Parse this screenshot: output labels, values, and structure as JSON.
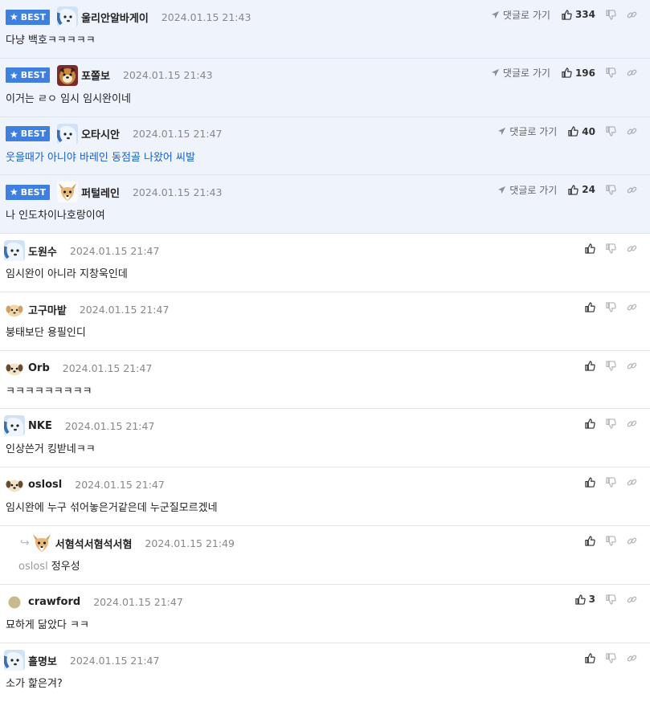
{
  "badge_label": "BEST",
  "go_label": "댓글로 가기",
  "best": [
    {
      "nick": "울리안알바게이",
      "time": "2024.01.15 21:43",
      "text": "다냥 백호ㅋㅋㅋㅋㅋ",
      "likes": "334",
      "avatar": "puppy-blue"
    },
    {
      "nick": "포쫄보",
      "time": "2024.01.15 21:43",
      "text": "이거는 ㄹㅇ 임시 임시완이네",
      "likes": "196",
      "avatar": "dog-red"
    },
    {
      "nick": "오타시안",
      "time": "2024.01.15 21:47",
      "text": "웃을때가 아니야 바레인 동점골 나왔어 씨발",
      "likes": "40",
      "avatar": "puppy-blue"
    },
    {
      "nick": "퍼털레인",
      "time": "2024.01.15 21:43",
      "text": "나 인도차이나호랑이여",
      "likes": "24",
      "avatar": "fox"
    }
  ],
  "comments": [
    {
      "nick": "도원수",
      "time": "2024.01.15 21:47",
      "text": "임시완이 아니라 지창욱인데",
      "avatar": "puppy-blue"
    },
    {
      "nick": "고구마밭",
      "time": "2024.01.15 21:47",
      "text": "붕태보단 용필인디",
      "avatar": "puppy-light"
    },
    {
      "nick": "Orb",
      "time": "2024.01.15 21:47",
      "text": "ㅋㅋㅋㅋㅋㅋㅋㅋㅋ",
      "avatar": "puppy-dark"
    },
    {
      "nick": "NKE",
      "time": "2024.01.15 21:47",
      "text": "인상쓴거 킹받네ㅋㅋ",
      "avatar": "puppy-blue"
    },
    {
      "nick": "oslosl",
      "time": "2024.01.15 21:47",
      "text": "임시완에 누구 섞어놓은거같은데 누군질모르겠네",
      "avatar": "puppy-dark"
    },
    {
      "nick": "서혐석서혐석서혐",
      "time": "2024.01.15 21:49",
      "mention": "oslosl",
      "text": "정우성",
      "avatar": "fox",
      "reply": true
    },
    {
      "nick": "crawford",
      "time": "2024.01.15 21:47",
      "text": "묘하게 닮았다 ㅋㅋ",
      "likes": "3",
      "avatar": "circle"
    },
    {
      "nick": "흘명보",
      "time": "2024.01.15 21:47",
      "text": "소가 핥은겨?",
      "avatar": "puppy-blue"
    }
  ],
  "colors": {
    "badge": "#3f7fe0",
    "best_bg": "#eef3fc",
    "blue_text": "#1a5fc7"
  }
}
